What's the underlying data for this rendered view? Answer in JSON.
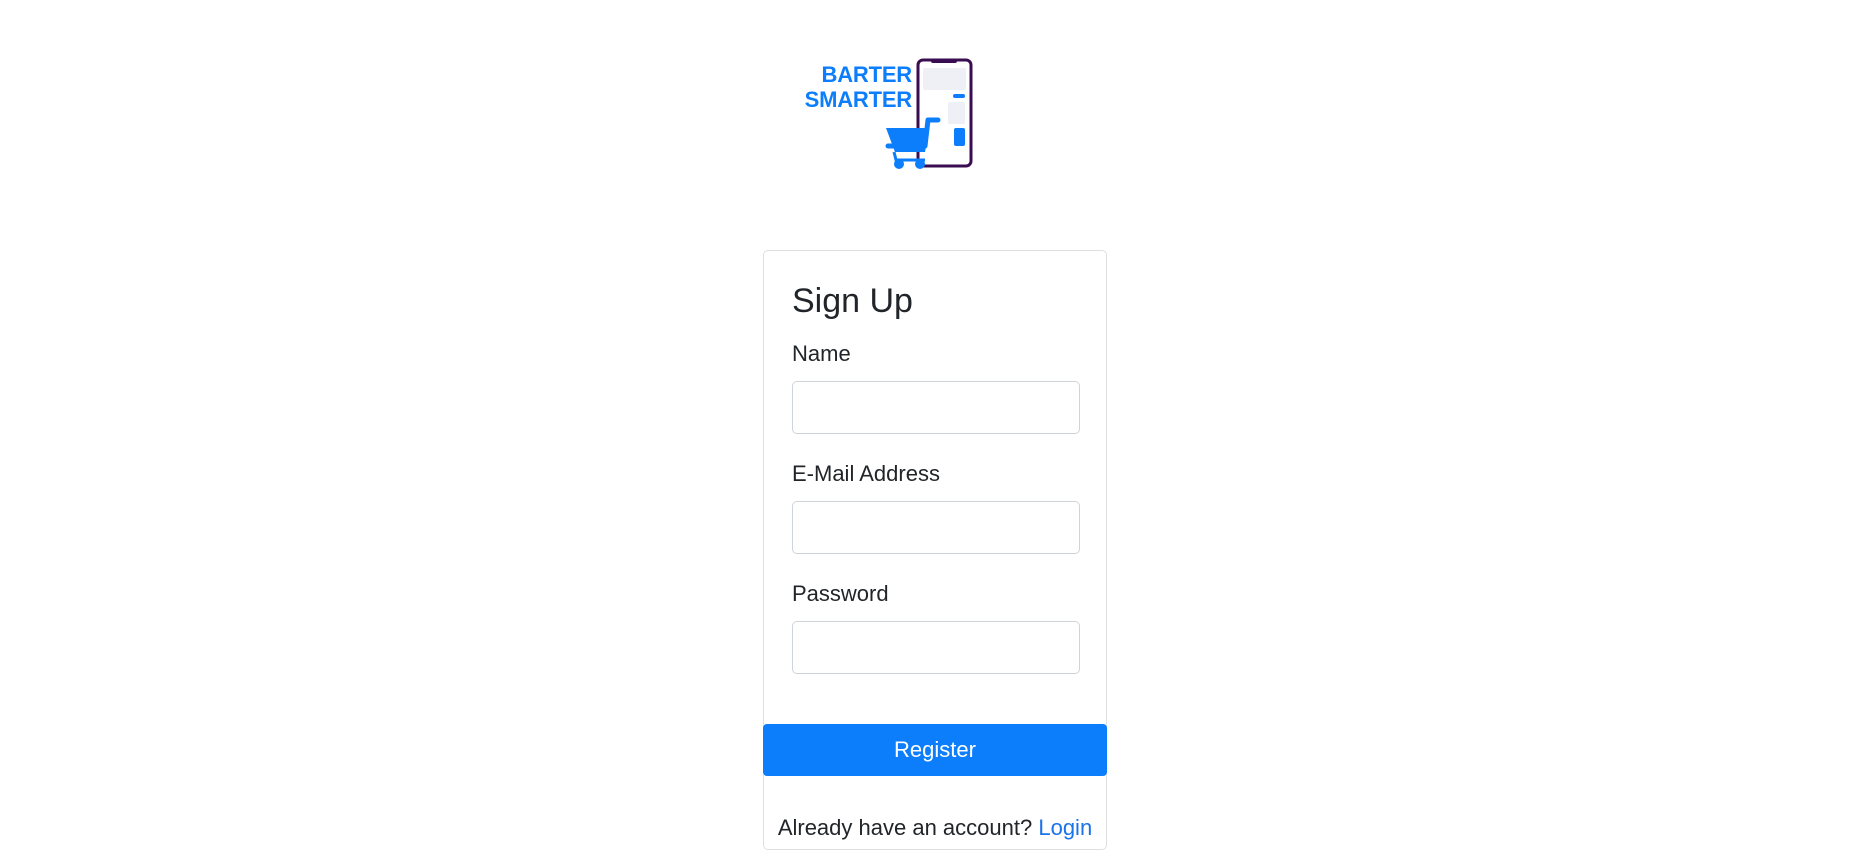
{
  "logo": {
    "line1": "BARTER",
    "line2": "SMARTER",
    "icon": "phone-cart-logo",
    "brand_color": "#0d7efb",
    "phone_color": "#3a0d52"
  },
  "form": {
    "title": "Sign Up",
    "name_label": "Name",
    "name_value": "",
    "email_label": "E-Mail Address",
    "email_value": "",
    "password_label": "Password",
    "password_value": "",
    "submit_label": "Register",
    "submit_color": "#0d7efb"
  },
  "footer": {
    "prompt": "Already have an account?",
    "link_label": "Login",
    "link_color": "#1a73e8"
  }
}
